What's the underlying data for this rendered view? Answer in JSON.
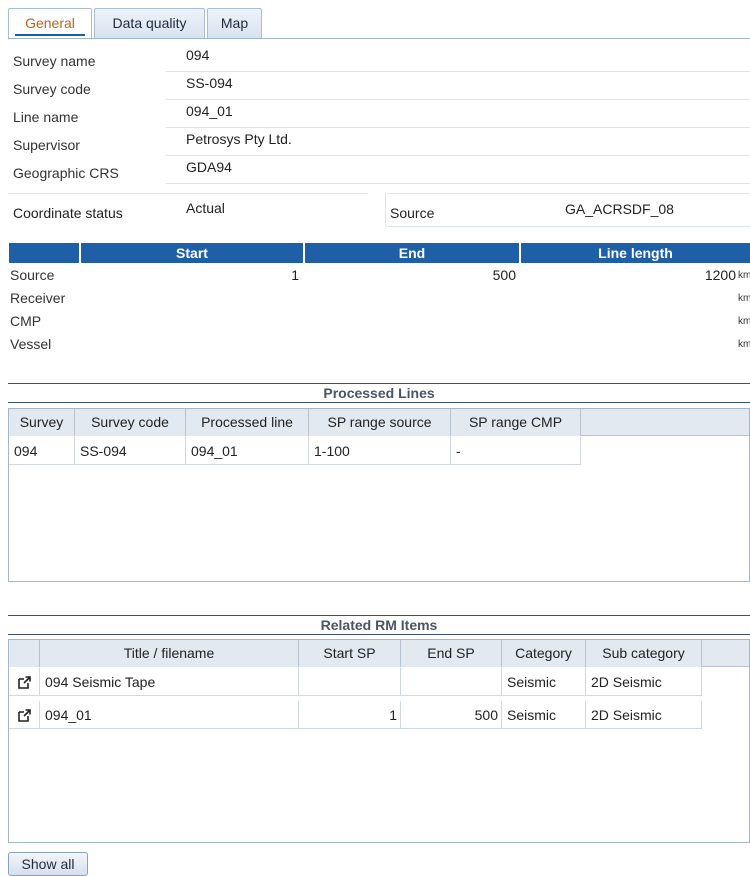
{
  "tabs": [
    {
      "label": "General",
      "active": true
    },
    {
      "label": "Data quality",
      "active": false
    },
    {
      "label": "Map",
      "active": false
    }
  ],
  "fields": {
    "survey_name": {
      "label": "Survey name",
      "value": "094"
    },
    "survey_code": {
      "label": "Survey code",
      "value": "SS-094"
    },
    "line_name": {
      "label": "Line name",
      "value": "094_01"
    },
    "supervisor": {
      "label": "Supervisor",
      "value": "Petrosys Pty Ltd."
    },
    "geographic_crs": {
      "label": "Geographic CRS",
      "value": "GDA94"
    },
    "coordinate_status": {
      "label": "Coordinate status",
      "value": "Actual"
    },
    "source": {
      "label": "Source",
      "value": "GA_ACRSDF_08"
    }
  },
  "measures": {
    "headers": {
      "start": "Start",
      "end": "End",
      "line_length": "Line length"
    },
    "rows": [
      {
        "label": "Source",
        "start": "1",
        "end": "500",
        "length": "1200",
        "unit": "km"
      },
      {
        "label": "Receiver",
        "start": "",
        "end": "",
        "length": "",
        "unit": "km"
      },
      {
        "label": "CMP",
        "start": "",
        "end": "",
        "length": "",
        "unit": "km"
      },
      {
        "label": "Vessel",
        "start": "",
        "end": "",
        "length": "",
        "unit": "km"
      }
    ]
  },
  "processed_lines": {
    "title": "Processed Lines",
    "columns": [
      "Survey",
      "Survey code",
      "Processed line",
      "SP range source",
      "SP range CMP"
    ],
    "rows": [
      [
        "094",
        "SS-094",
        "094_01",
        "1-100",
        "-"
      ]
    ]
  },
  "related_rm_items": {
    "title": "Related RM Items",
    "columns": [
      "",
      "Title / filename",
      "Start SP",
      "End SP",
      "Category",
      "Sub category"
    ],
    "rows": [
      {
        "icon": "open-external-icon",
        "title": "094 Seismic Tape",
        "start_sp": "",
        "end_sp": "",
        "category": "Seismic",
        "sub_category": "2D Seismic"
      },
      {
        "icon": "open-external-icon",
        "title": "094_01",
        "start_sp": "1",
        "end_sp": "500",
        "category": "Seismic",
        "sub_category": "2D Seismic"
      }
    ]
  },
  "buttons": {
    "show_all": "Show all"
  },
  "colors": {
    "tab_active_text": "#c2601a",
    "header_blue": "#1f5fa8",
    "section_rule": "#3b4f7a"
  }
}
